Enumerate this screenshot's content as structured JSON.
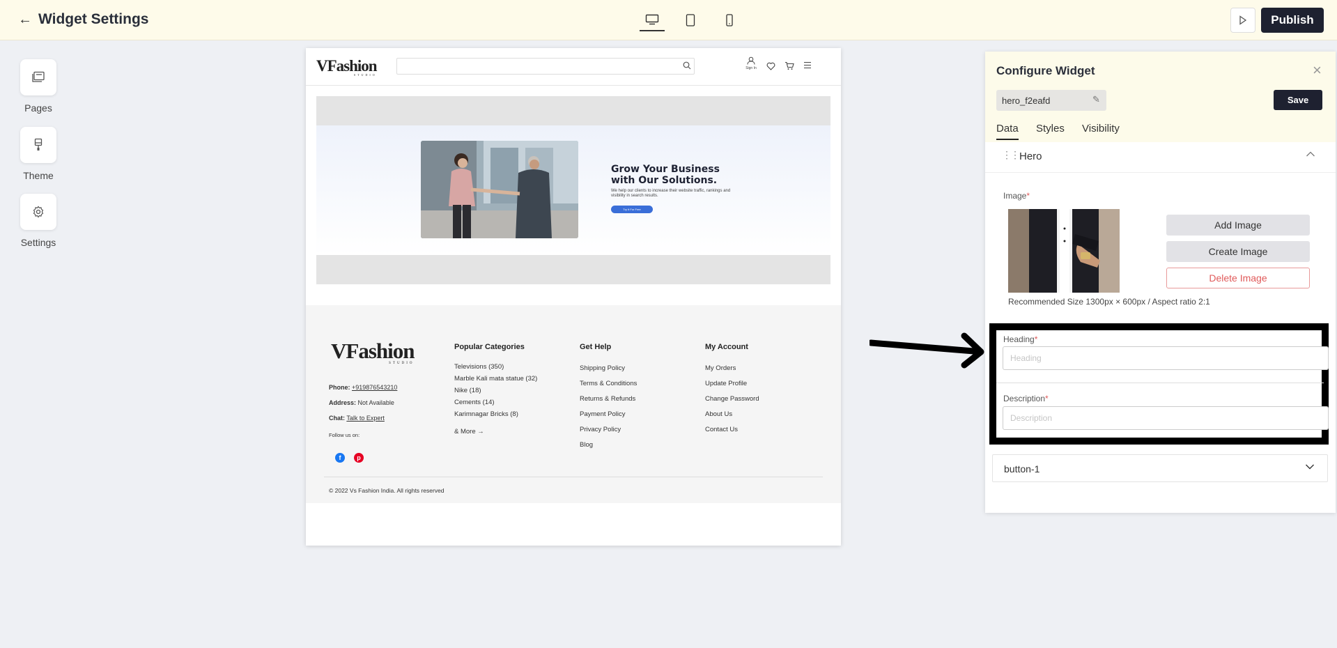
{
  "header": {
    "title": "Widget Settings",
    "publish_label": "Publish"
  },
  "sidebar": {
    "items": [
      {
        "label": "Pages",
        "icon": "pages-icon"
      },
      {
        "label": "Theme",
        "icon": "brush-icon"
      },
      {
        "label": "Settings",
        "icon": "gear-icon"
      }
    ]
  },
  "preview": {
    "header": {
      "logo_main": "VFashion",
      "logo_sub": "STUDIO",
      "signin_label": "Sign In"
    },
    "hero": {
      "heading": "Grow Your Business with Our Solutions.",
      "description": "We help our clients to increase their website traffic, rankings and visibility in search results.",
      "cta": "Try It For Free"
    },
    "footer": {
      "phone_label": "Phone:",
      "phone_value": "+919876543210",
      "address_label": "Address:",
      "address_value": "Not Available",
      "chat_label": "Chat:",
      "chat_value": "Talk to Expert",
      "follow_label": "Follow us on:",
      "popular": {
        "title": "Popular Categories",
        "items": [
          "Televisions (350)",
          "Marble Kali mata statue (32)",
          "Nike (18)",
          "Cements (14)",
          "Karimnagar Bricks (8)"
        ],
        "more": "& More →"
      },
      "help": {
        "title": "Get Help",
        "items": [
          "Shipping Policy",
          "Terms & Conditions",
          "Returns & Refunds",
          "Payment Policy",
          "Privacy Policy",
          "Blog"
        ]
      },
      "account": {
        "title": "My Account",
        "items": [
          "My Orders",
          "Update Profile",
          "Change Password",
          "About Us",
          "Contact Us"
        ]
      },
      "copyright": "© 2022 Vs Fashion India. All rights reserved"
    }
  },
  "panel": {
    "title": "Configure Widget",
    "widget_id": "hero_f2eafd",
    "save_label": "Save",
    "tabs": [
      "Data",
      "Styles",
      "Visibility"
    ],
    "section_title": "Hero",
    "image_label": "Image",
    "add_image": "Add Image",
    "create_image": "Create Image",
    "delete_image": "Delete Image",
    "recommended": "Recommended Size 1300px × 600px / Aspect ratio 2:1",
    "heading_label": "Heading",
    "heading_placeholder": "Heading",
    "description_label": "Description",
    "description_placeholder": "Description",
    "button_section": "button-1"
  },
  "colors": {
    "topbar_bg": "#fefbea",
    "dark_btn": "#1e2130",
    "danger": "#e05a5a",
    "cta_blue": "#3a6ed8"
  }
}
